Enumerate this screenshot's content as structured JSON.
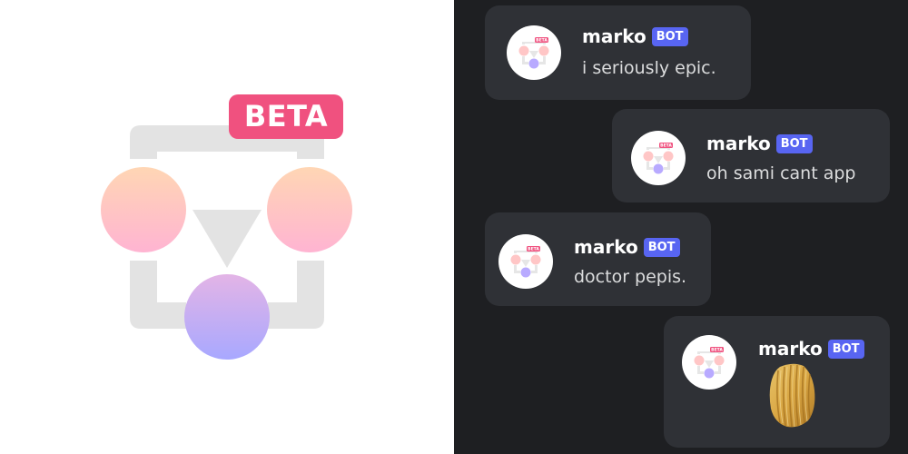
{
  "logo": {
    "badge_text": "BETA",
    "colors": {
      "badge": "#f0517f",
      "bracket": "#e3e3e3",
      "circle_top": [
        "#ffd6b4",
        "#ffb4d2"
      ],
      "circle_bottom": [
        "#e3b4e6",
        "#a8a8ff"
      ]
    }
  },
  "chat": {
    "messages": [
      {
        "author": "marko",
        "tag": "BOT",
        "text": "i seriously epic.",
        "avatar_badge": "BETA"
      },
      {
        "author": "marko",
        "tag": "BOT",
        "text": "oh sami cant app",
        "avatar_badge": "BETA"
      },
      {
        "author": "marko",
        "tag": "BOT",
        "text": "doctor pepis.",
        "avatar_badge": "BETA"
      },
      {
        "author": "marko",
        "tag": "BOT",
        "text": "",
        "attachment": "potato-chip-image",
        "avatar_badge": "BETA"
      }
    ],
    "colors": {
      "background": "#1e1f22",
      "bubble": "#2f3136",
      "bot_tag": "#5865f2",
      "username": "#ffffff",
      "text": "#dcddde"
    }
  }
}
